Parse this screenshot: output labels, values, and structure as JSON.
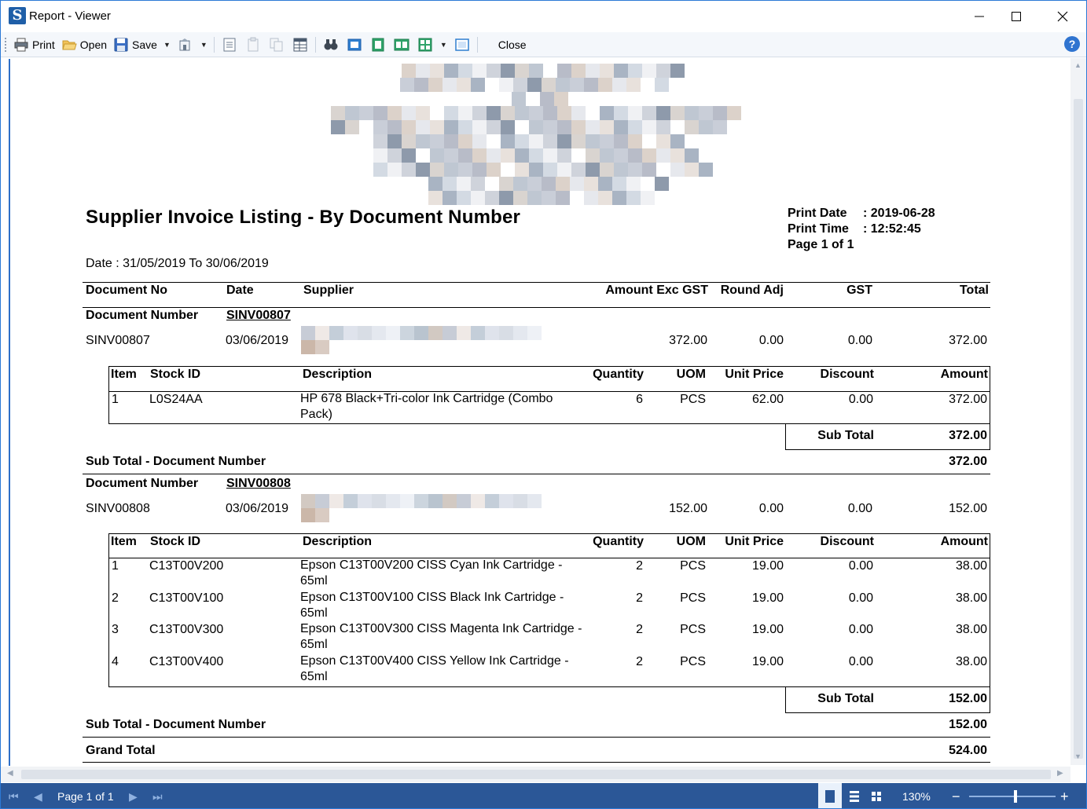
{
  "window": {
    "title": "Report - Viewer"
  },
  "toolbar": {
    "print_label": "Print",
    "open_label": "Open",
    "save_label": "Save",
    "close_label": "Close"
  },
  "report": {
    "title": "Supplier Invoice Listing - By Document Number",
    "print_date_label": "Print Date",
    "print_date_value": ": 2019-06-28",
    "print_time_label": "Print Time",
    "print_time_value": ": 12:52:45",
    "page_info": "Page 1 of 1",
    "date_range": "Date : 31/05/2019 To 30/06/2019",
    "columns": {
      "doc_no": "Document No",
      "date": "Date",
      "supplier": "Supplier",
      "amount_exc_gst": "Amount Exc GST",
      "round_adj": "Round Adj",
      "gst": "GST",
      "total": "Total"
    },
    "detail_columns": {
      "item": "Item",
      "stock_id": "Stock ID",
      "description": "Description",
      "quantity": "Quantity",
      "uom": "UOM",
      "unit_price": "Unit Price",
      "discount": "Discount",
      "amount": "Amount"
    },
    "group_label": "Document Number",
    "subtotal_label": "Sub Total",
    "group_subtotal_label": "Sub Total - Document Number",
    "grand_total_label": "Grand Total",
    "grand_total": "524.00",
    "groups": [
      {
        "doc_number": "SINV00807",
        "doc_no": "SINV00807",
        "date": "03/06/2019",
        "amount_exc_gst": "372.00",
        "round_adj": "0.00",
        "gst": "0.00",
        "total": "372.00",
        "items": [
          {
            "item": "1",
            "stock_id": "L0S24AA",
            "description": "HP 678 Black+Tri-color Ink Cartridge (Combo Pack)",
            "quantity": "6",
            "uom": "PCS",
            "unit_price": "62.00",
            "discount": "0.00",
            "amount": "372.00"
          }
        ],
        "sub_total": "372.00",
        "group_sub_total": "372.00"
      },
      {
        "doc_number": "SINV00808",
        "doc_no": "SINV00808",
        "date": "03/06/2019",
        "amount_exc_gst": "152.00",
        "round_adj": "0.00",
        "gst": "0.00",
        "total": "152.00",
        "items": [
          {
            "item": "1",
            "stock_id": "C13T00V200",
            "description": "Epson C13T00V200 CISS Cyan Ink Cartridge - 65ml",
            "quantity": "2",
            "uom": "PCS",
            "unit_price": "19.00",
            "discount": "0.00",
            "amount": "38.00"
          },
          {
            "item": "2",
            "stock_id": "C13T00V100",
            "description": "Epson C13T00V100 CISS Black Ink Cartridge - 65ml",
            "quantity": "2",
            "uom": "PCS",
            "unit_price": "19.00",
            "discount": "0.00",
            "amount": "38.00"
          },
          {
            "item": "3",
            "stock_id": "C13T00V300",
            "description": "Epson C13T00V300 CISS Magenta Ink Cartridge - 65ml",
            "quantity": "2",
            "uom": "PCS",
            "unit_price": "19.00",
            "discount": "0.00",
            "amount": "38.00"
          },
          {
            "item": "4",
            "stock_id": "C13T00V400",
            "description": "Epson C13T00V400 CISS Yellow Ink Cartridge - 65ml",
            "quantity": "2",
            "uom": "PCS",
            "unit_price": "19.00",
            "discount": "0.00",
            "amount": "38.00"
          }
        ],
        "sub_total": "152.00",
        "group_sub_total": "152.00"
      }
    ]
  },
  "statusbar": {
    "page_label": "Page 1 of 1",
    "zoom": "130%"
  },
  "colors": {
    "accent": "#2b79d6",
    "statusbar": "#2b5797"
  },
  "icons": [
    "app-logo-icon",
    "minimize-icon",
    "maximize-icon",
    "close-icon",
    "print-icon",
    "open-folder-icon",
    "save-icon",
    "export-icon",
    "find-icon",
    "help-icon",
    "first-page-icon",
    "previous-page-icon",
    "next-page-icon",
    "last-page-icon",
    "zoom-out-icon",
    "zoom-in-icon"
  ]
}
